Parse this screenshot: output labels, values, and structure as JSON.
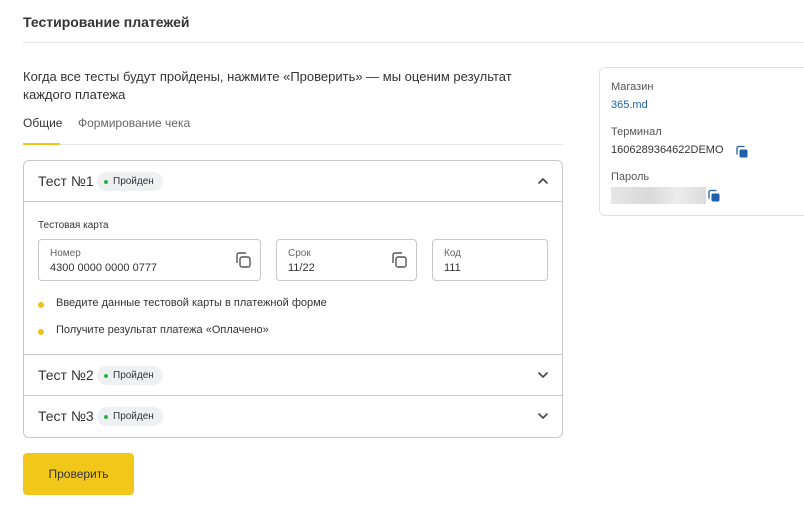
{
  "page": {
    "title": "Тестирование платежей",
    "description": "Когда все тесты будут пройдены, нажмите «Проверить» — мы оценим результат каждого платежа"
  },
  "tabs": [
    {
      "label": "Общие",
      "active": true
    },
    {
      "label": "Формирование чека",
      "active": false
    }
  ],
  "tests": [
    {
      "name": "Тест №1",
      "status": "Пройден",
      "expanded": true,
      "card_section_label": "Тестовая карта",
      "fields": {
        "number": {
          "label": "Номер",
          "value": "4300 0000 0000 0777"
        },
        "expiry": {
          "label": "Срок",
          "value": "11/22"
        },
        "code": {
          "label": "Код",
          "value": "111"
        }
      },
      "steps": [
        "Введите данные тестовой карты в платежной форме",
        "Получите результат платежа «Оплачено»"
      ]
    },
    {
      "name": "Тест №2",
      "status": "Пройден",
      "expanded": false
    },
    {
      "name": "Тест №3",
      "status": "Пройден",
      "expanded": false
    }
  ],
  "actions": {
    "check_label": "Проверить"
  },
  "info": {
    "shop_label": "Магазин",
    "shop_value": "365.md",
    "terminal_label": "Терминал",
    "terminal_value": "1606289364622DEMO",
    "password_label": "Пароль"
  },
  "icons": {
    "copy": "copy-icon",
    "chevron_up": "chevron-up-icon",
    "chevron_down": "chevron-down-icon",
    "status_dot": "status-dot-icon"
  },
  "colors": {
    "accent": "#f1c81a",
    "status_green": "#2bb34a",
    "link_blue": "#1f5ea8",
    "copy_icon_blue": "#1f5ea8",
    "badge_bg": "#eef0f2",
    "border": "#c8c8c8"
  }
}
